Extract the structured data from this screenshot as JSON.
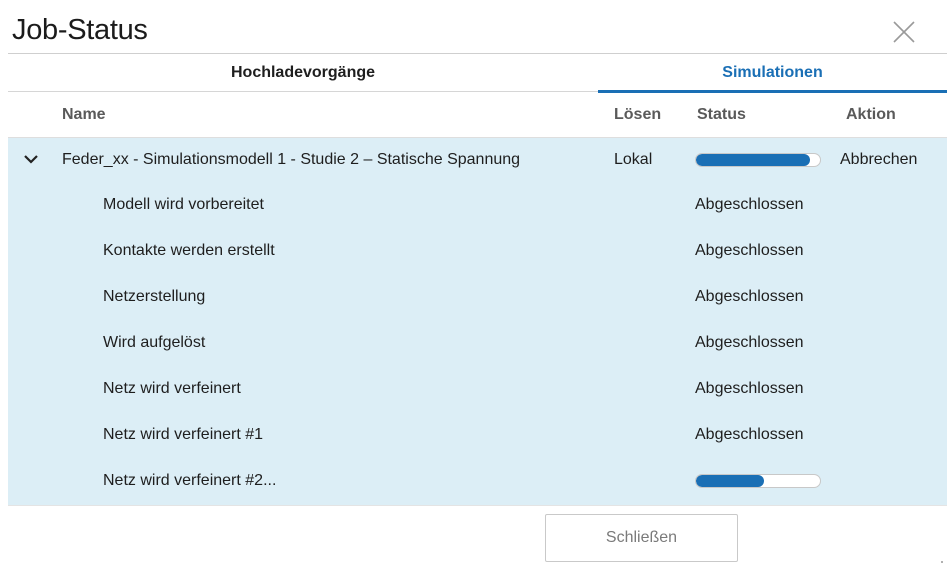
{
  "title": "Job-Status",
  "tabs": [
    {
      "label": "Hochladevorgänge",
      "active": false
    },
    {
      "label": "Simulationen",
      "active": true
    }
  ],
  "columns": {
    "name": "Name",
    "solve": "Lösen",
    "status": "Status",
    "action": "Aktion"
  },
  "job": {
    "name": "Feder_xx - Simulationsmodell 1 - Studie 2 – Statische Spannung",
    "solve": "Lokal",
    "progress": 0.92,
    "action": "Abbrechen"
  },
  "steps": [
    {
      "name": "Modell wird vorbereitet",
      "status": "Abgeschlossen"
    },
    {
      "name": "Kontakte werden erstellt",
      "status": "Abgeschlossen"
    },
    {
      "name": "Netzerstellung",
      "status": "Abgeschlossen"
    },
    {
      "name": "Wird aufgelöst",
      "status": "Abgeschlossen"
    },
    {
      "name": "Netz wird verfeinert",
      "status": "Abgeschlossen"
    },
    {
      "name": "Netz wird verfeinert #1",
      "status": "Abgeschlossen"
    },
    {
      "name": "Netz wird verfeinert #2...",
      "status": "",
      "progress": 0.55
    }
  ],
  "footer": {
    "close_label": "Schließen"
  },
  "colors": {
    "accent": "#1a6fb5",
    "panel": "#dceef6"
  },
  "icons": {
    "close": "close-icon",
    "expand": "chevron-down-icon"
  }
}
